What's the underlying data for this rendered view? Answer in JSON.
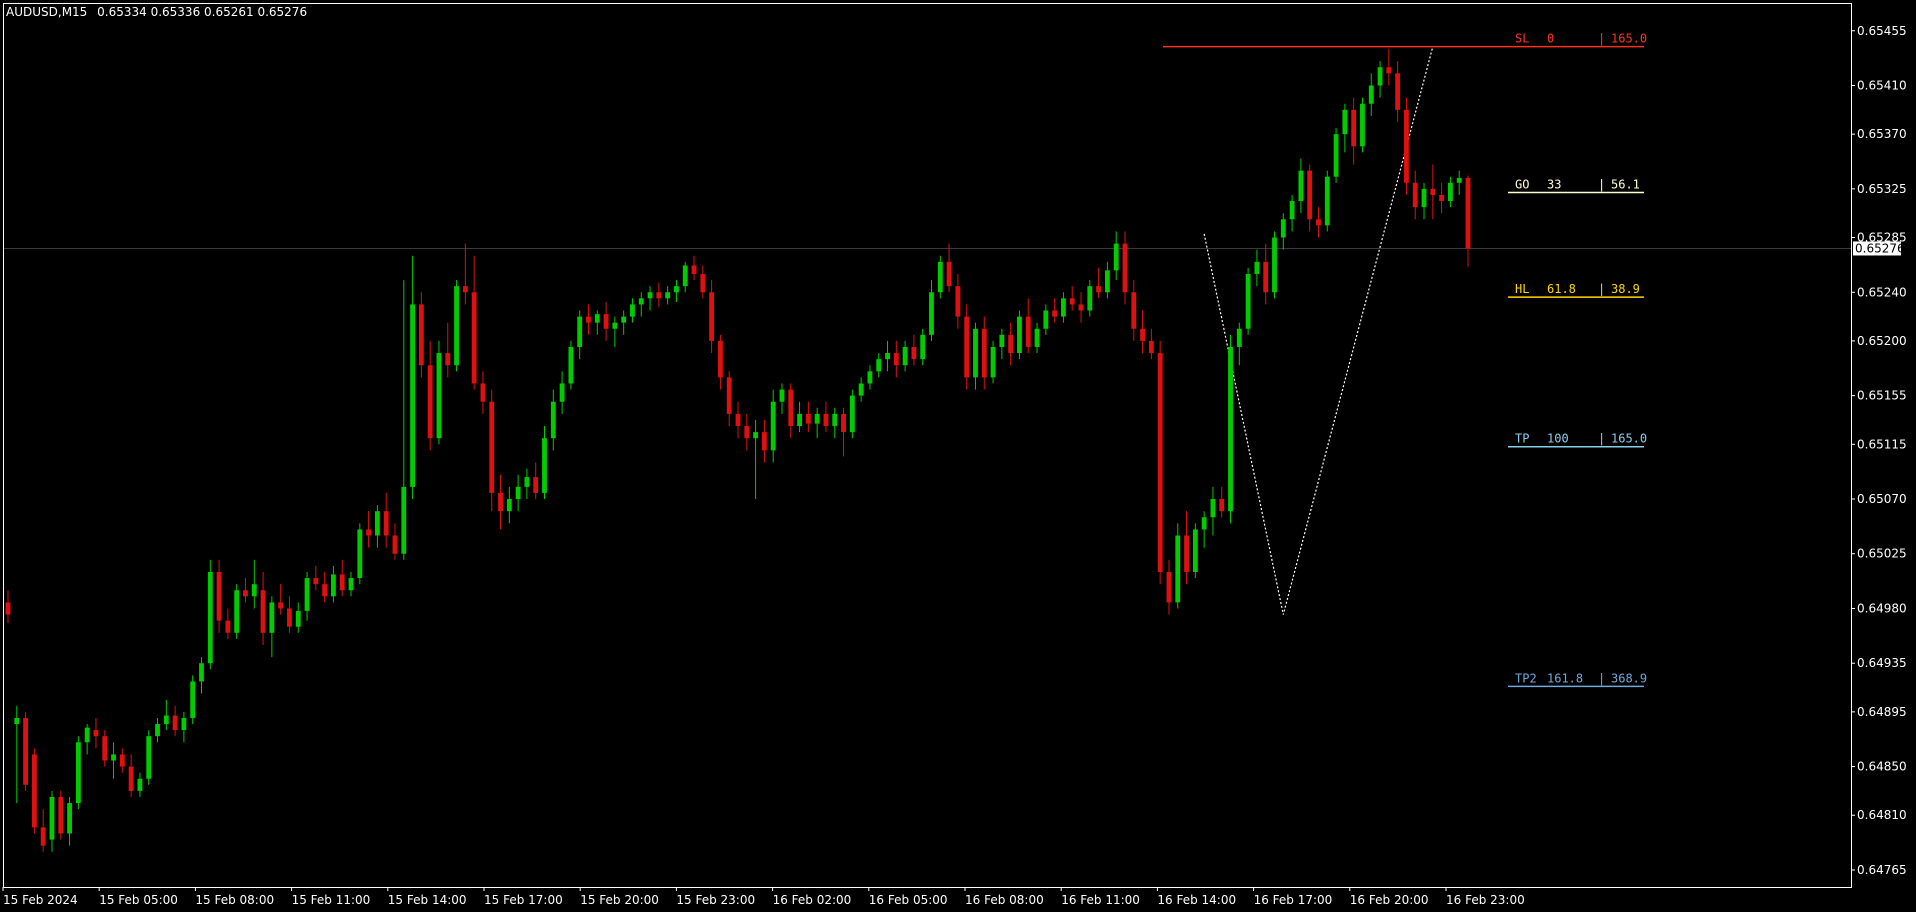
{
  "header": {
    "symbol": "AUDUSD,M15",
    "ohlc": "0.65334 0.65336 0.65261 0.65276"
  },
  "colors": {
    "background": "#000000",
    "frame": "#ffffff",
    "bull": "#00cc00",
    "bear": "#dd1111",
    "bid_line": "#3a3a3a",
    "zigzag": "#ffffff",
    "sl": "#ff3322",
    "go": "#ffffcc",
    "hl": "#ffd700",
    "tp": "#87ceeb",
    "tp2": "#6fa8dc"
  },
  "price_axis": {
    "labels": [
      "0.65455",
      "0.65410",
      "0.65370",
      "0.65325",
      "0.65285",
      "0.65240",
      "0.65200",
      "0.65155",
      "0.65115",
      "0.65070",
      "0.65025",
      "0.64980",
      "0.64935",
      "0.64895",
      "0.64850",
      "0.64810",
      "0.64765"
    ],
    "current_price": "0.65276"
  },
  "time_axis": {
    "labels": [
      "15 Feb 2024",
      "15 Feb 05:00",
      "15 Feb 08:00",
      "15 Feb 11:00",
      "15 Feb 14:00",
      "15 Feb 17:00",
      "15 Feb 20:00",
      "15 Feb 23:00",
      "16 Feb 02:00",
      "16 Feb 05:00",
      "16 Feb 08:00",
      "16 Feb 11:00",
      "16 Feb 14:00",
      "16 Feb 17:00",
      "16 Feb 20:00",
      "16 Feb 23:00"
    ]
  },
  "levels": [
    {
      "key": "sl",
      "name": "SL",
      "ratio": "0",
      "value": "165.0",
      "price": 0.65442,
      "color": "#ff3322"
    },
    {
      "key": "go",
      "name": "GO",
      "ratio": "33",
      "value": "56.1",
      "price": 0.65322,
      "color": "#ffffcc"
    },
    {
      "key": "hl",
      "name": "HL",
      "ratio": "61.8",
      "value": "38.9",
      "price": 0.65236,
      "color": "#ffd700"
    },
    {
      "key": "tp",
      "name": "TP",
      "ratio": "100",
      "value": "165.0",
      "price": 0.65113,
      "color": "#87ceeb"
    },
    {
      "key": "tp2",
      "name": "TP2",
      "ratio": "161.8",
      "value": "368.9",
      "price": 0.64916,
      "color": "#6fa8dc"
    }
  ],
  "chart_data": {
    "type": "candlestick",
    "title": "AUDUSD,M15",
    "ylim": [
      0.64751,
      0.65477
    ],
    "current_price": 0.65276,
    "candles": [
      [
        0.64985,
        0.64995,
        0.64968,
        0.64975
      ],
      [
        0.64885,
        0.649,
        0.6482,
        0.6489
      ],
      [
        0.6489,
        0.64895,
        0.6483,
        0.64835
      ],
      [
        0.6486,
        0.64865,
        0.64795,
        0.648
      ],
      [
        0.648,
        0.64815,
        0.6478,
        0.64785
      ],
      [
        0.6479,
        0.6483,
        0.6478,
        0.64825
      ],
      [
        0.64825,
        0.6483,
        0.6479,
        0.64795
      ],
      [
        0.64795,
        0.64825,
        0.64785,
        0.6482
      ],
      [
        0.6482,
        0.64875,
        0.64815,
        0.6487
      ],
      [
        0.6487,
        0.64885,
        0.6486,
        0.64882
      ],
      [
        0.6488,
        0.6489,
        0.64865,
        0.64875
      ],
      [
        0.64875,
        0.6488,
        0.6485,
        0.64855
      ],
      [
        0.64855,
        0.6487,
        0.6484,
        0.6486
      ],
      [
        0.6486,
        0.64865,
        0.64845,
        0.6485
      ],
      [
        0.6485,
        0.6486,
        0.64825,
        0.6483
      ],
      [
        0.6483,
        0.64845,
        0.64825,
        0.6484
      ],
      [
        0.6484,
        0.6488,
        0.64835,
        0.64875
      ],
      [
        0.64875,
        0.6489,
        0.6487,
        0.64885
      ],
      [
        0.64885,
        0.64905,
        0.6488,
        0.64892
      ],
      [
        0.64892,
        0.649,
        0.64875,
        0.6488
      ],
      [
        0.6488,
        0.64895,
        0.6487,
        0.6489
      ],
      [
        0.6489,
        0.64925,
        0.64885,
        0.6492
      ],
      [
        0.6492,
        0.6494,
        0.6491,
        0.64935
      ],
      [
        0.64935,
        0.6502,
        0.6493,
        0.6501
      ],
      [
        0.6501,
        0.6502,
        0.6496,
        0.6497
      ],
      [
        0.6497,
        0.6498,
        0.64955,
        0.6496
      ],
      [
        0.6496,
        0.65,
        0.64955,
        0.64995
      ],
      [
        0.64995,
        0.65005,
        0.64985,
        0.6499
      ],
      [
        0.6499,
        0.6502,
        0.6498,
        0.65
      ],
      [
        0.64995,
        0.6501,
        0.6495,
        0.6496
      ],
      [
        0.6496,
        0.6499,
        0.6494,
        0.64985
      ],
      [
        0.64985,
        0.65,
        0.64975,
        0.6498
      ],
      [
        0.6498,
        0.6499,
        0.6496,
        0.64965
      ],
      [
        0.64965,
        0.64985,
        0.6496,
        0.64978
      ],
      [
        0.64978,
        0.6501,
        0.6497,
        0.65005
      ],
      [
        0.65005,
        0.65015,
        0.64995,
        0.65
      ],
      [
        0.65,
        0.6501,
        0.64985,
        0.6499
      ],
      [
        0.6499,
        0.65015,
        0.64985,
        0.65008
      ],
      [
        0.65008,
        0.6502,
        0.6499,
        0.64995
      ],
      [
        0.64995,
        0.6501,
        0.6499,
        0.65005
      ],
      [
        0.65005,
        0.6505,
        0.65,
        0.65045
      ],
      [
        0.65045,
        0.6506,
        0.6503,
        0.6504
      ],
      [
        0.6504,
        0.65065,
        0.6503,
        0.6506
      ],
      [
        0.6506,
        0.65075,
        0.6503,
        0.6504
      ],
      [
        0.6504,
        0.6505,
        0.6502,
        0.65025
      ],
      [
        0.65025,
        0.6525,
        0.6502,
        0.6508
      ],
      [
        0.6508,
        0.6527,
        0.6507,
        0.6523
      ],
      [
        0.6523,
        0.6524,
        0.6517,
        0.6518
      ],
      [
        0.6518,
        0.652,
        0.6511,
        0.6512
      ],
      [
        0.6512,
        0.652,
        0.65115,
        0.6519
      ],
      [
        0.6519,
        0.65215,
        0.6517,
        0.6518
      ],
      [
        0.6518,
        0.6525,
        0.65175,
        0.65245
      ],
      [
        0.65245,
        0.6528,
        0.6523,
        0.6524
      ],
      [
        0.6524,
        0.6527,
        0.6516,
        0.65165
      ],
      [
        0.65165,
        0.65175,
        0.6514,
        0.6515
      ],
      [
        0.6515,
        0.6516,
        0.6506,
        0.65075
      ],
      [
        0.65075,
        0.6509,
        0.65045,
        0.6506
      ],
      [
        0.6506,
        0.6508,
        0.6505,
        0.6507
      ],
      [
        0.6507,
        0.6509,
        0.6506,
        0.6508
      ],
      [
        0.6508,
        0.65095,
        0.6507,
        0.65088
      ],
      [
        0.65088,
        0.651,
        0.6507,
        0.65075
      ],
      [
        0.65075,
        0.6513,
        0.6507,
        0.6512
      ],
      [
        0.6512,
        0.6516,
        0.6511,
        0.6515
      ],
      [
        0.6515,
        0.65175,
        0.6514,
        0.65165
      ],
      [
        0.65165,
        0.652,
        0.6516,
        0.65195
      ],
      [
        0.65195,
        0.65225,
        0.65185,
        0.6522
      ],
      [
        0.6522,
        0.6523,
        0.65205,
        0.65215
      ],
      [
        0.65215,
        0.65225,
        0.65205,
        0.65222
      ],
      [
        0.65222,
        0.65232,
        0.652,
        0.6521
      ],
      [
        0.6521,
        0.6522,
        0.65195,
        0.65215
      ],
      [
        0.65215,
        0.65225,
        0.65205,
        0.6522
      ],
      [
        0.6522,
        0.65235,
        0.65215,
        0.6523
      ],
      [
        0.6523,
        0.6524,
        0.6522,
        0.65235
      ],
      [
        0.65235,
        0.65245,
        0.65225,
        0.6524
      ],
      [
        0.6524,
        0.65248,
        0.65228,
        0.65235
      ],
      [
        0.65235,
        0.65245,
        0.6523,
        0.6524
      ],
      [
        0.6524,
        0.6525,
        0.65232,
        0.65245
      ],
      [
        0.65245,
        0.65265,
        0.6524,
        0.65262
      ],
      [
        0.65262,
        0.6527,
        0.6525,
        0.65255
      ],
      [
        0.65255,
        0.65262,
        0.65235,
        0.6524
      ],
      [
        0.6524,
        0.6525,
        0.6519,
        0.652
      ],
      [
        0.652,
        0.65205,
        0.6516,
        0.6517
      ],
      [
        0.6517,
        0.65175,
        0.6513,
        0.6514
      ],
      [
        0.6514,
        0.6515,
        0.6512,
        0.6513
      ],
      [
        0.6513,
        0.6514,
        0.6511,
        0.6512
      ],
      [
        0.6512,
        0.65135,
        0.6507,
        0.65125
      ],
      [
        0.65125,
        0.65135,
        0.651,
        0.6511
      ],
      [
        0.6511,
        0.6516,
        0.651,
        0.6515
      ],
      [
        0.6515,
        0.65165,
        0.6514,
        0.6516
      ],
      [
        0.6516,
        0.65165,
        0.6512,
        0.6513
      ],
      [
        0.6513,
        0.6515,
        0.65125,
        0.6514
      ],
      [
        0.6514,
        0.6515,
        0.65125,
        0.65132
      ],
      [
        0.65132,
        0.65145,
        0.6512,
        0.6514
      ],
      [
        0.6514,
        0.6515,
        0.65125,
        0.6513
      ],
      [
        0.6513,
        0.65145,
        0.6512,
        0.6514
      ],
      [
        0.6514,
        0.65145,
        0.65105,
        0.65125
      ],
      [
        0.65125,
        0.6516,
        0.6512,
        0.65155
      ],
      [
        0.65155,
        0.6517,
        0.6515,
        0.65165
      ],
      [
        0.65165,
        0.6518,
        0.6516,
        0.65175
      ],
      [
        0.65175,
        0.6519,
        0.6517,
        0.65185
      ],
      [
        0.65185,
        0.652,
        0.65175,
        0.6519
      ],
      [
        0.6519,
        0.652,
        0.6517,
        0.6518
      ],
      [
        0.6518,
        0.652,
        0.65175,
        0.65195
      ],
      [
        0.65195,
        0.65205,
        0.6518,
        0.65185
      ],
      [
        0.65185,
        0.6521,
        0.6518,
        0.65205
      ],
      [
        0.65205,
        0.6525,
        0.652,
        0.6524
      ],
      [
        0.6524,
        0.6527,
        0.65235,
        0.65265
      ],
      [
        0.65265,
        0.6528,
        0.6524,
        0.65245
      ],
      [
        0.65245,
        0.65255,
        0.6521,
        0.6522
      ],
      [
        0.6522,
        0.6523,
        0.6516,
        0.6517
      ],
      [
        0.6517,
        0.65215,
        0.6516,
        0.6521
      ],
      [
        0.6521,
        0.6522,
        0.6516,
        0.6517
      ],
      [
        0.6517,
        0.652,
        0.65165,
        0.65195
      ],
      [
        0.65195,
        0.6521,
        0.65185,
        0.65205
      ],
      [
        0.65205,
        0.65215,
        0.6518,
        0.6519
      ],
      [
        0.6519,
        0.65225,
        0.65185,
        0.6522
      ],
      [
        0.6522,
        0.65235,
        0.6519,
        0.65195
      ],
      [
        0.65195,
        0.65215,
        0.6519,
        0.6521
      ],
      [
        0.6521,
        0.6523,
        0.65205,
        0.65225
      ],
      [
        0.65225,
        0.65235,
        0.65215,
        0.6522
      ],
      [
        0.6522,
        0.6524,
        0.65215,
        0.65235
      ],
      [
        0.65235,
        0.65245,
        0.65225,
        0.6523
      ],
      [
        0.6523,
        0.6524,
        0.65215,
        0.65225
      ],
      [
        0.65225,
        0.6525,
        0.6522,
        0.65245
      ],
      [
        0.65245,
        0.6526,
        0.65235,
        0.6524
      ],
      [
        0.6524,
        0.65265,
        0.65235,
        0.65258
      ],
      [
        0.65258,
        0.6529,
        0.6525,
        0.6528
      ],
      [
        0.6528,
        0.6529,
        0.6523,
        0.6524
      ],
      [
        0.6524,
        0.6525,
        0.652,
        0.6521
      ],
      [
        0.6521,
        0.65225,
        0.6519,
        0.652
      ],
      [
        0.652,
        0.6521,
        0.65185,
        0.6519
      ],
      [
        0.6519,
        0.652,
        0.65,
        0.6501
      ],
      [
        0.6501,
        0.6502,
        0.64975,
        0.64985
      ],
      [
        0.64985,
        0.6505,
        0.6498,
        0.6504
      ],
      [
        0.6504,
        0.6506,
        0.65,
        0.6501
      ],
      [
        0.6501,
        0.6505,
        0.65005,
        0.65045
      ],
      [
        0.65045,
        0.6506,
        0.6503,
        0.65055
      ],
      [
        0.65055,
        0.6508,
        0.6504,
        0.6507
      ],
      [
        0.6507,
        0.6508,
        0.65055,
        0.6506
      ],
      [
        0.6506,
        0.65205,
        0.6505,
        0.65195
      ],
      [
        0.65195,
        0.65215,
        0.6518,
        0.6521
      ],
      [
        0.6521,
        0.6526,
        0.65205,
        0.65255
      ],
      [
        0.65255,
        0.65275,
        0.65245,
        0.65265
      ],
      [
        0.65265,
        0.6528,
        0.6523,
        0.6524
      ],
      [
        0.6524,
        0.6529,
        0.65235,
        0.65285
      ],
      [
        0.65285,
        0.65305,
        0.65275,
        0.653
      ],
      [
        0.653,
        0.6532,
        0.6529,
        0.65315
      ],
      [
        0.65315,
        0.6535,
        0.65305,
        0.6534
      ],
      [
        0.6534,
        0.65345,
        0.6529,
        0.653
      ],
      [
        0.653,
        0.6531,
        0.65285,
        0.65295
      ],
      [
        0.65295,
        0.6534,
        0.6529,
        0.65335
      ],
      [
        0.65335,
        0.65375,
        0.6533,
        0.6537
      ],
      [
        0.6537,
        0.65395,
        0.65355,
        0.6539
      ],
      [
        0.6539,
        0.654,
        0.65345,
        0.6536
      ],
      [
        0.6536,
        0.654,
        0.65355,
        0.65395
      ],
      [
        0.65395,
        0.6542,
        0.65385,
        0.6541
      ],
      [
        0.6541,
        0.6543,
        0.654,
        0.65425
      ],
      [
        0.65425,
        0.6544,
        0.6541,
        0.6542
      ],
      [
        0.6542,
        0.6543,
        0.6538,
        0.6539
      ],
      [
        0.6539,
        0.654,
        0.6532,
        0.6533
      ],
      [
        0.6533,
        0.6534,
        0.653,
        0.6531
      ],
      [
        0.6531,
        0.6533,
        0.653,
        0.65325
      ],
      [
        0.65325,
        0.65345,
        0.653,
        0.6532
      ],
      [
        0.6532,
        0.6533,
        0.65305,
        0.65315
      ],
      [
        0.65315,
        0.65335,
        0.6531,
        0.6533
      ],
      [
        0.6533,
        0.6534,
        0.6532,
        0.65334
      ],
      [
        0.65334,
        0.65336,
        0.65261,
        0.65276
      ]
    ],
    "zigzag_prices": [
      0.65288,
      0.64975,
      0.65442
    ]
  }
}
